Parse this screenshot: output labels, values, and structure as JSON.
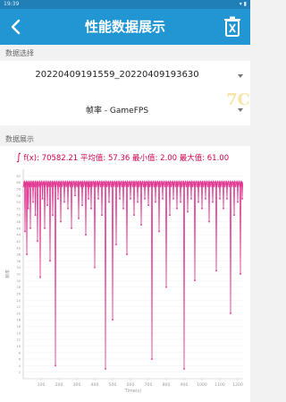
{
  "status_bar": {
    "time": "19:39",
    "icons": "▾ ▮"
  },
  "header": {
    "title": "性能数据展示",
    "back_icon": "chevron-left-icon",
    "delete_icon": "trash-icon"
  },
  "data_select": {
    "section_label": "数据选择",
    "record_value": "20220409191559_20220409193630",
    "metric_value": "帧率 - GameFPS",
    "watermark": "7C"
  },
  "data_display": {
    "section_label": "数据展示",
    "formula_symbol": "∫",
    "formula_text": "f(x): 70582.21  平均值: 57.36  最小值: 2.00  最大值: 61.00"
  },
  "chart_data": {
    "type": "line",
    "x_label": "Time(s)",
    "y_label": "帧率",
    "xlim": [
      0,
      1230
    ],
    "ylim": [
      0,
      64
    ],
    "x_ticks": [
      "100",
      "200",
      "300",
      "400",
      "500",
      "600",
      "700",
      "800",
      "900",
      "1000",
      "1100",
      "1200"
    ],
    "y_ticks": [
      "2",
      "4",
      "6",
      "8",
      "10",
      "12",
      "14",
      "16",
      "18",
      "20",
      "22",
      "24",
      "26",
      "28",
      "30",
      "32",
      "34",
      "36",
      "38",
      "40",
      "42",
      "44",
      "46",
      "48",
      "50",
      "52",
      "54",
      "56",
      "58",
      "60",
      "62"
    ],
    "series_color": "#e0338f",
    "baseline": 60,
    "dips": [
      [
        10,
        45
      ],
      [
        20,
        38
      ],
      [
        28,
        52
      ],
      [
        40,
        46
      ],
      [
        55,
        54
      ],
      [
        68,
        50
      ],
      [
        80,
        42
      ],
      [
        95,
        31
      ],
      [
        108,
        55
      ],
      [
        120,
        46
      ],
      [
        135,
        53
      ],
      [
        150,
        36
      ],
      [
        165,
        50
      ],
      [
        180,
        4
      ],
      [
        195,
        55
      ],
      [
        210,
        48
      ],
      [
        230,
        54
      ],
      [
        250,
        52
      ],
      [
        270,
        46
      ],
      [
        290,
        56
      ],
      [
        310,
        49
      ],
      [
        330,
        53
      ],
      [
        350,
        44
      ],
      [
        365,
        55
      ],
      [
        380,
        52
      ],
      [
        400,
        34
      ],
      [
        420,
        55
      ],
      [
        440,
        50
      ],
      [
        460,
        3
      ],
      [
        480,
        54
      ],
      [
        500,
        18
      ],
      [
        520,
        41
      ],
      [
        540,
        55
      ],
      [
        560,
        52
      ],
      [
        580,
        38
      ],
      [
        600,
        55
      ],
      [
        620,
        50
      ],
      [
        640,
        54
      ],
      [
        660,
        47
      ],
      [
        680,
        55
      ],
      [
        700,
        53
      ],
      [
        720,
        6
      ],
      [
        740,
        54
      ],
      [
        760,
        45
      ],
      [
        780,
        55
      ],
      [
        800,
        28
      ],
      [
        820,
        50
      ],
      [
        840,
        55
      ],
      [
        860,
        52
      ],
      [
        880,
        54
      ],
      [
        900,
        3
      ],
      [
        920,
        51
      ],
      [
        940,
        55
      ],
      [
        960,
        30
      ],
      [
        980,
        54
      ],
      [
        1000,
        52
      ],
      [
        1020,
        55
      ],
      [
        1040,
        48
      ],
      [
        1060,
        54
      ],
      [
        1080,
        33
      ],
      [
        1100,
        55
      ],
      [
        1120,
        52
      ],
      [
        1140,
        55
      ],
      [
        1160,
        20
      ],
      [
        1180,
        50
      ],
      [
        1200,
        54
      ],
      [
        1215,
        32
      ],
      [
        1225,
        55
      ]
    ]
  }
}
